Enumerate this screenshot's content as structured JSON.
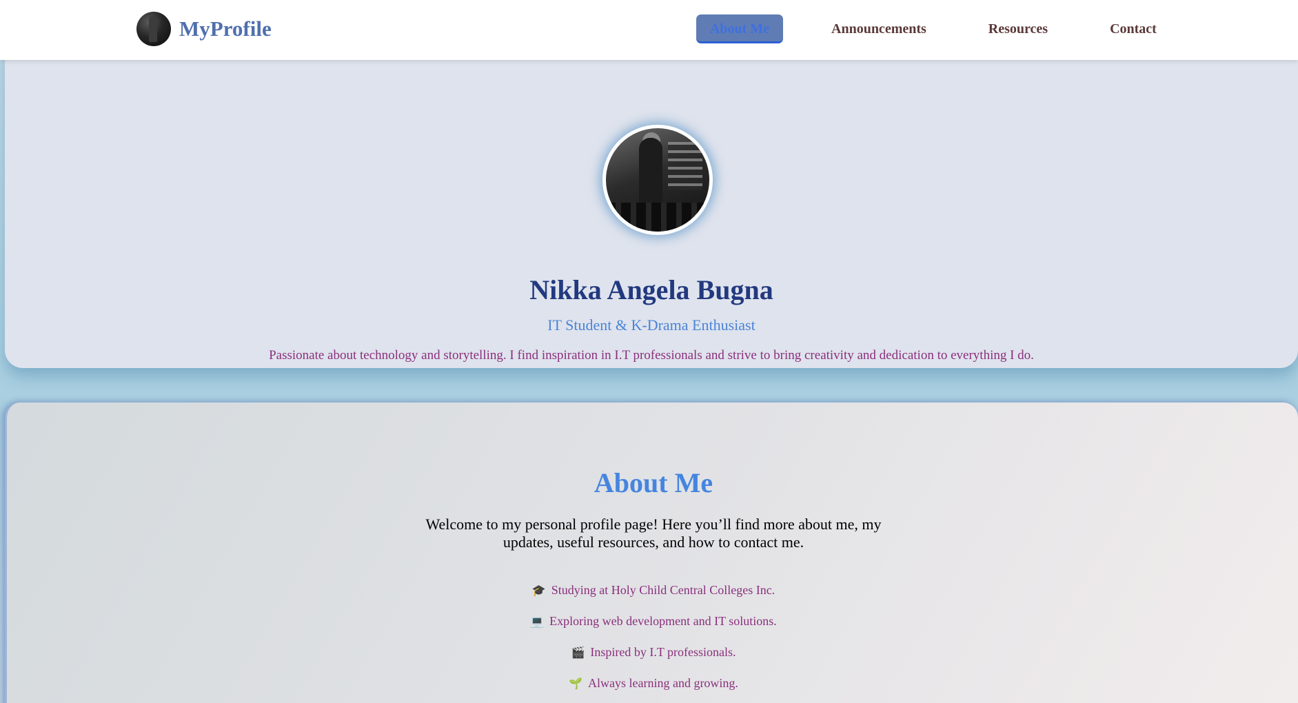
{
  "brand": {
    "name": "MyProfile",
    "logo_icon": "profile-photo-icon"
  },
  "nav": {
    "items": [
      {
        "label": "About Me",
        "active": true
      },
      {
        "label": "Announcements",
        "active": false
      },
      {
        "label": "Resources",
        "active": false
      },
      {
        "label": "Contact",
        "active": false
      }
    ]
  },
  "hero": {
    "avatar_icon": "profile-photo",
    "name": "Nikka Angela Bugna",
    "tagline": "IT Student & K-Drama Enthusiast",
    "bio": "Passionate about technology and storytelling. I find inspiration in I.T professionals and strive to bring creativity and dedication to everything I do."
  },
  "about": {
    "title": "About Me",
    "intro": "Welcome to my personal profile page! Here you’ll find more about me, my updates, useful resources, and how to contact me.",
    "items": [
      {
        "emoji": "🎓",
        "text": "Studying at Holy Child Central Colleges Inc."
      },
      {
        "emoji": "💻",
        "text": "Exploring web development and IT solutions."
      },
      {
        "emoji": "🎬",
        "text": "Inspired by I.T professionals."
      },
      {
        "emoji": "🌱",
        "text": "Always learning and growing."
      }
    ]
  },
  "colors": {
    "brand": "#4f6fae",
    "nav_active_bg": "#5f7db4",
    "name": "#22397f",
    "tagline": "#4a84d6",
    "bio": "#8a2f7c",
    "about_title": "#4585e0"
  }
}
